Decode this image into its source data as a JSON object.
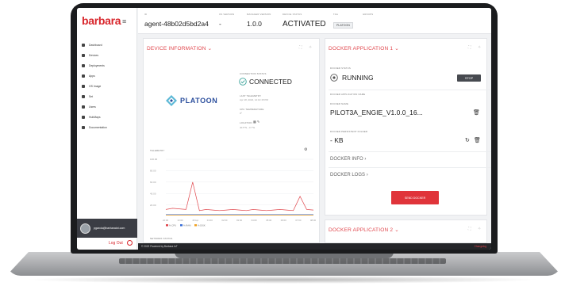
{
  "app": {
    "logo": "barbara"
  },
  "sidebar": {
    "items": [
      {
        "label": "Dashboard",
        "icon": "dashboard-icon"
      },
      {
        "label": "Devices",
        "icon": "devices-icon"
      },
      {
        "label": "Deployments",
        "icon": "deployments-icon"
      },
      {
        "label": "Apps",
        "icon": "apps-icon"
      },
      {
        "label": "OS Image",
        "icon": "os-image-icon"
      },
      {
        "label": "Set",
        "icon": "set-icon"
      },
      {
        "label": "Users",
        "icon": "users-icon"
      },
      {
        "label": "HubMaps",
        "icon": "hubmaps-icon"
      },
      {
        "label": "Documentation",
        "icon": "documentation-icon"
      }
    ],
    "user_email": "pgarcia@barbaraiot.com",
    "logout": "Log Out"
  },
  "header": {
    "id_label": "ID",
    "id_value": "agent-48b02d5bd2a4",
    "os_label": "OS VERSION",
    "os_value": "-",
    "manager_label": "MANAGER VERSION",
    "manager_value": "1.0.0",
    "status_label": "DEVICE STATUS",
    "status_value": "ACTIVATED",
    "tag_label": "TAG",
    "tag_value": "PLATOON",
    "groups_label": "GROUPS"
  },
  "device_info": {
    "title": "DEVICE INFORMATION",
    "logo_text": "PLATOON",
    "connection_label": "CONNECTION STATUS",
    "connection_value": "CONNECTED",
    "last_telemetry_label": "LAST TELEMETRY",
    "last_telemetry_value": "Apr 18, 2022, 12:10:15 PM",
    "cpu_label": "CPU TEMPERATURE",
    "cpu_value": "0º",
    "location_label": "LOCATION",
    "location_value": "40.5°N, -3.7°E",
    "telemetry_label": "TELEMETRY",
    "network_label": "NETWORK STATUS"
  },
  "chart_data": {
    "type": "line",
    "x": [
      "22:00",
      "23:00",
      "18 Apr",
      "01:00",
      "02:00",
      "03:00",
      "04:00",
      "05:00",
      "06:00",
      "07:00",
      "08:00"
    ],
    "y_ticks": [
      "100.00",
      "80.00",
      "60.00",
      "40.00",
      "20.00"
    ],
    "series": [
      {
        "name": "% CPU",
        "color": "#e0464c",
        "values": [
          12,
          14,
          13,
          12,
          60,
          10,
          12,
          11,
          10,
          11,
          12,
          11,
          10,
          12,
          11,
          10,
          11,
          12,
          11,
          10,
          35,
          12,
          11
        ]
      },
      {
        "name": "% RAM",
        "color": "#3a6fd8",
        "values": [
          3,
          3,
          3,
          3,
          3,
          3,
          3,
          3,
          3,
          3,
          3,
          3,
          3,
          3,
          3,
          3,
          3,
          3,
          3,
          3,
          3,
          3,
          3
        ]
      },
      {
        "name": "% DISK",
        "color": "#f0a020",
        "values": [
          2,
          2,
          2,
          2,
          2,
          2,
          2,
          2,
          2,
          2,
          2,
          2,
          2,
          2,
          2,
          2,
          2,
          2,
          2,
          2,
          2,
          2,
          2
        ]
      }
    ],
    "ylim": [
      0,
      100
    ]
  },
  "docker1": {
    "title": "DOCKER APPLICATION 1",
    "status_label": "DOCKER STATUS",
    "status_value": "RUNNING",
    "stop_label": "STOP",
    "docker_name_label": "DOCKER APPLICATION NAME",
    "image_label": "DOCKER NAME",
    "image_value": "PILOT3A_ENGIE_V1.0.0_16...",
    "size_label": "DOCKER PERSISTENT FOLDER",
    "size_value": "- KB",
    "info_link": "DOCKER INFO",
    "logs_link": "DOCKER LOGS",
    "send_label": "SEND DOCKER"
  },
  "docker2": {
    "title": "DOCKER APPLICATION 2"
  },
  "footer": {
    "left": "© 2022 Powered by Barbara IoT",
    "right": "Changelog"
  }
}
